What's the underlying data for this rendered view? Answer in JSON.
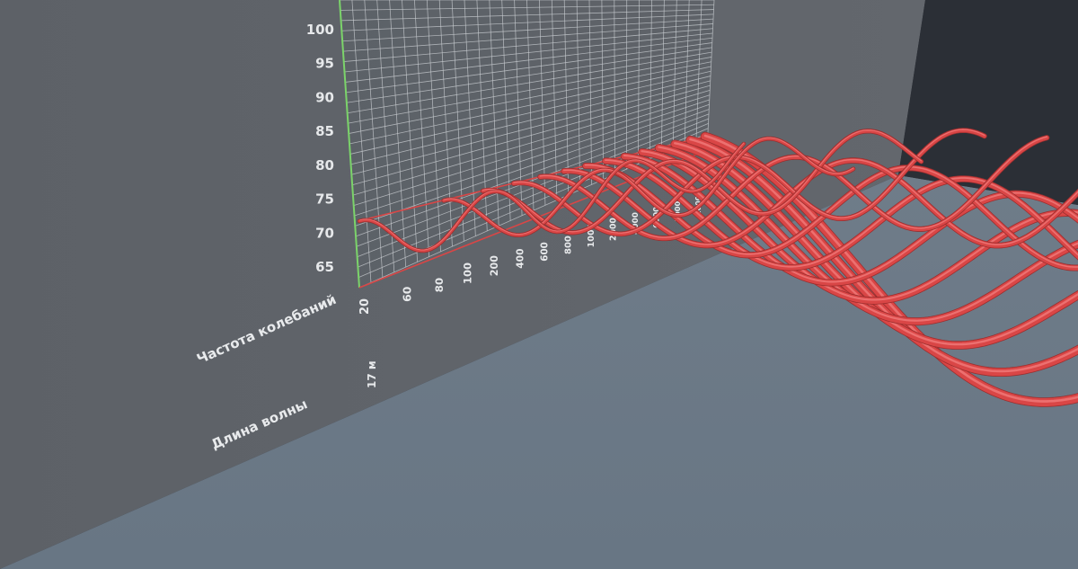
{
  "chart_data": {
    "type": "line",
    "view": "3d-perspective",
    "y_axis": {
      "ticks": [
        100,
        95,
        90,
        85,
        80,
        75,
        70,
        65
      ],
      "range": [
        62,
        104
      ]
    },
    "x_axis": {
      "title": "Частота колебаний",
      "ticks": [
        "20",
        "60",
        "80",
        "100",
        "200",
        "400",
        "600",
        "800",
        "1000",
        "2000",
        "4000",
        "6000",
        "10000",
        "20000"
      ]
    },
    "z_axis": {
      "title": "Длина волны",
      "tick": "17 м"
    },
    "series_count": 14,
    "grid": true,
    "colors": {
      "curve": "#d94646",
      "curve_highlight": "#f07a7a",
      "grid": "#c9cdd2",
      "y_axis_line": "#7bd36a",
      "wall": "#5c6167",
      "floor": "#6c7a88",
      "back_room": "#2b2f36"
    }
  }
}
